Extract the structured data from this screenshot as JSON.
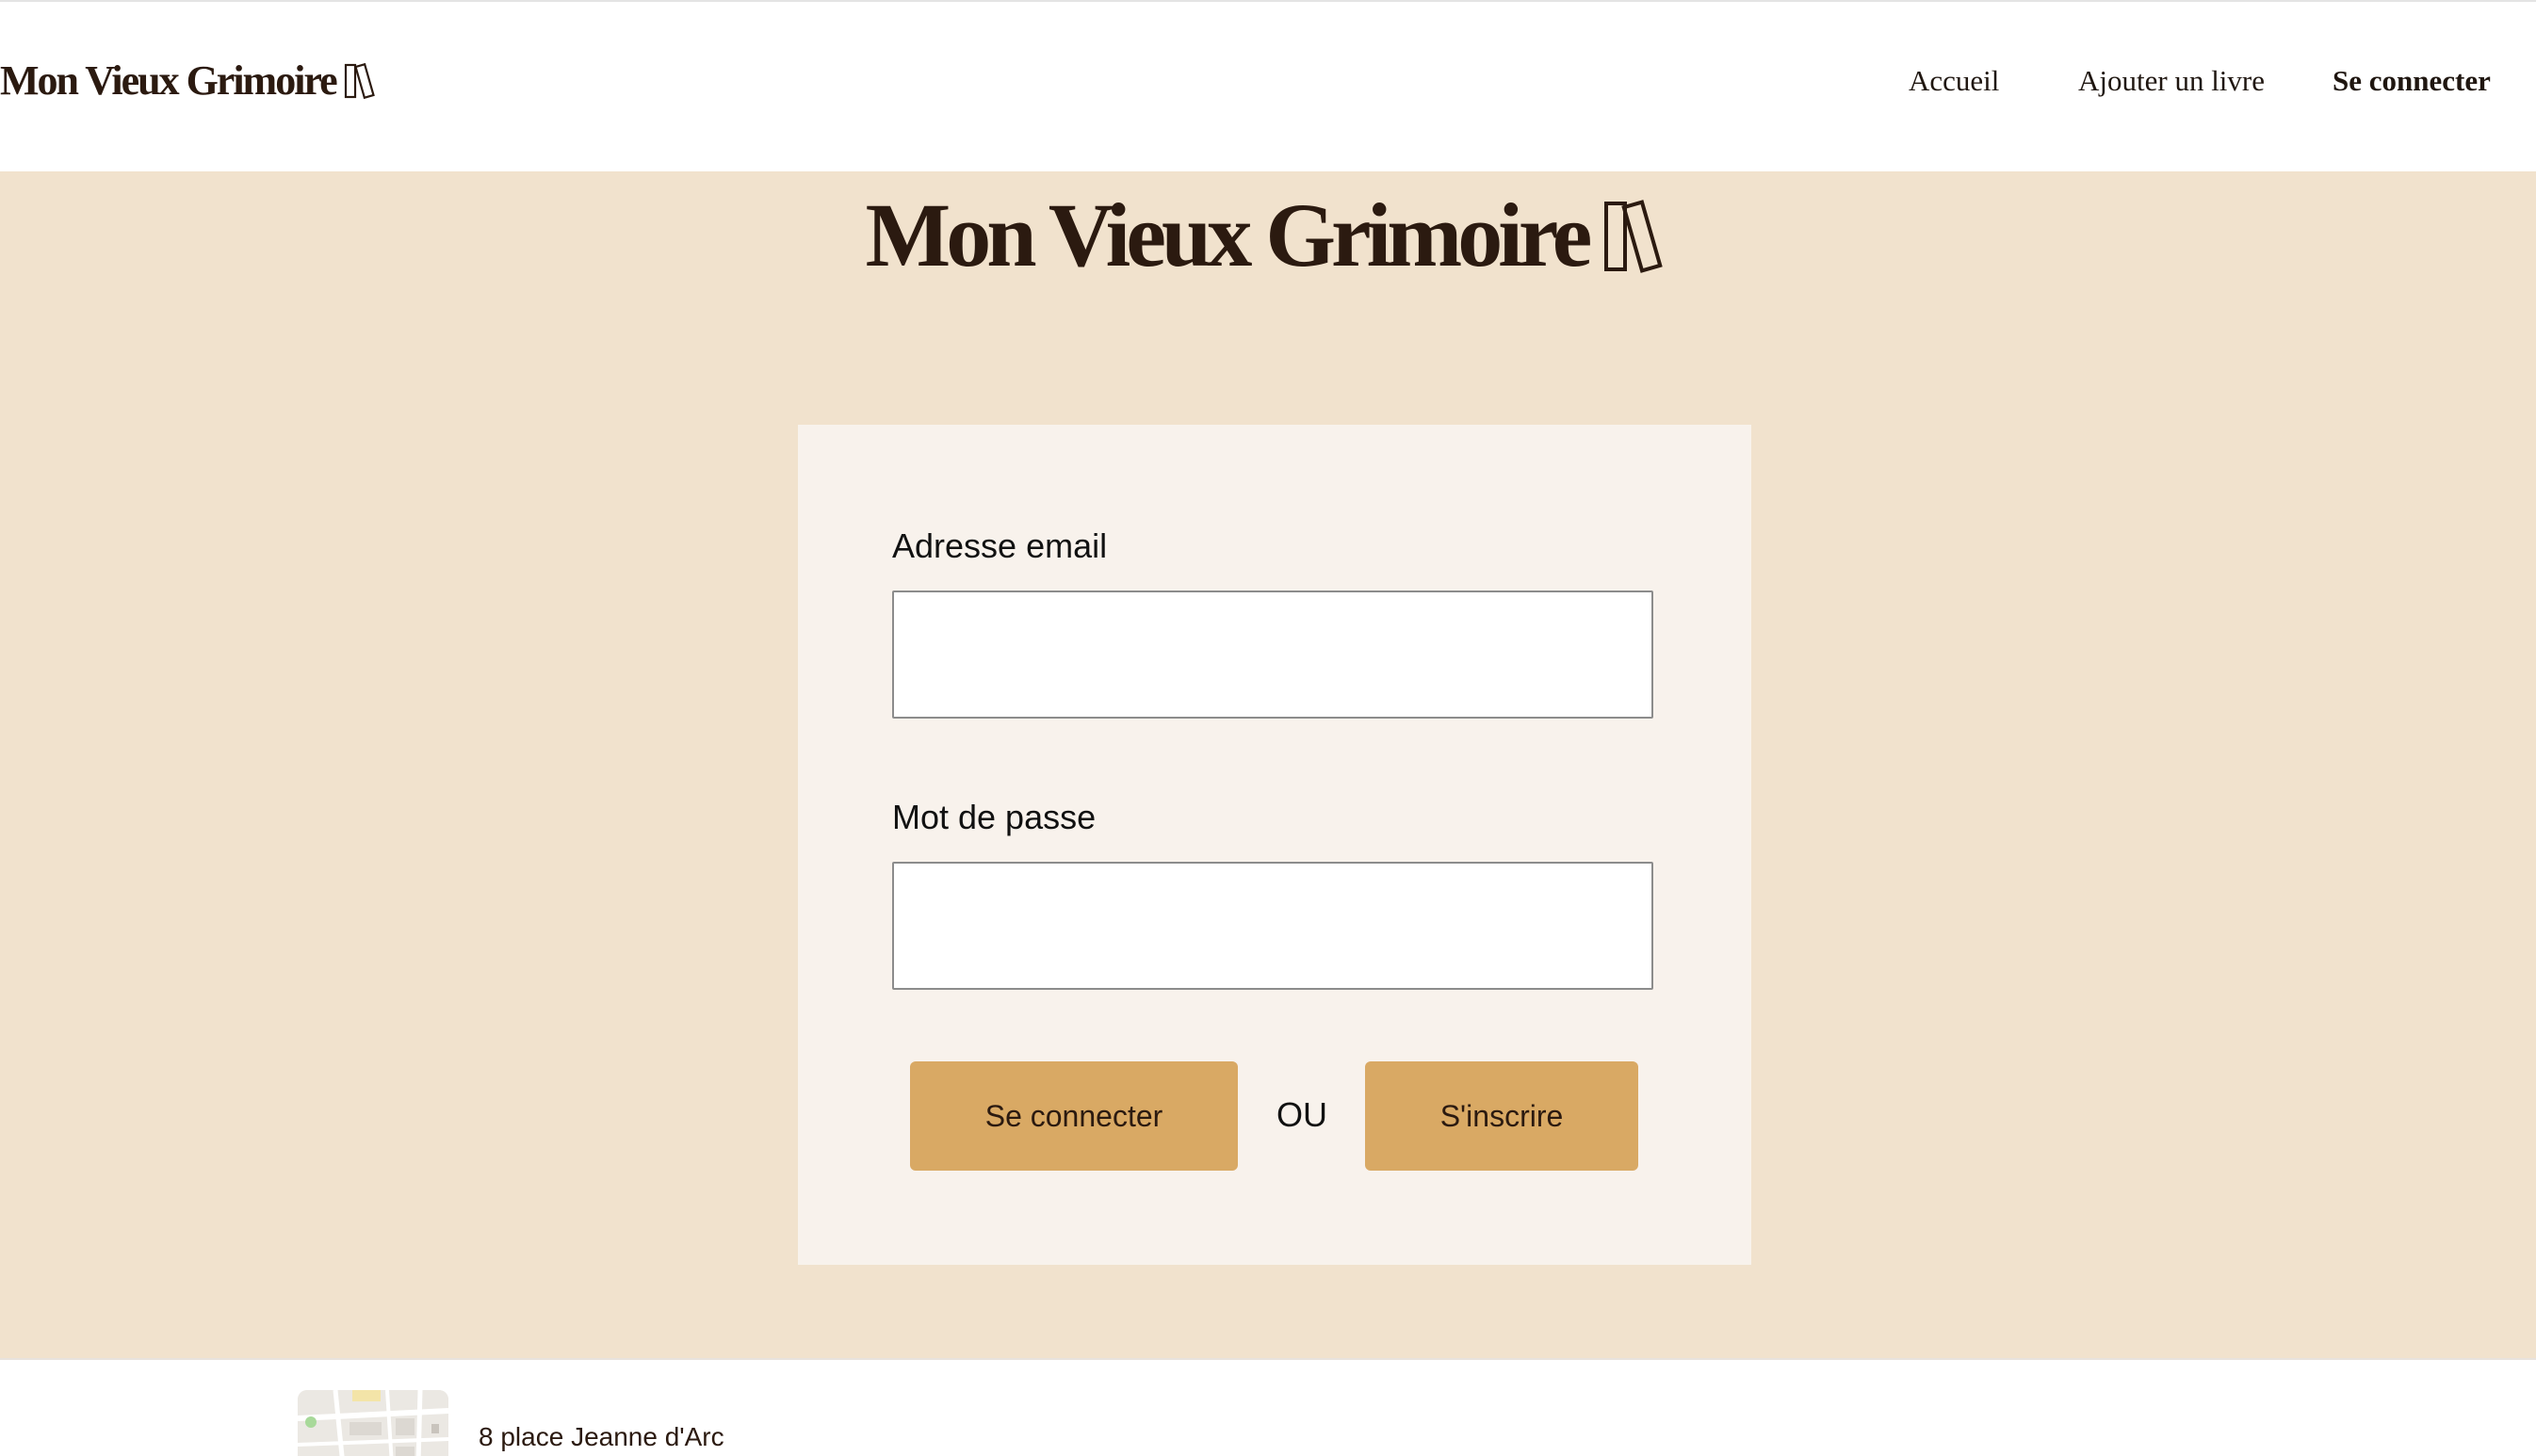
{
  "header": {
    "logo_text": "Mon Vieux Grimoire",
    "logo_icon": "books-icon",
    "nav": [
      {
        "label": "Accueil"
      },
      {
        "label": "Ajouter un livre"
      },
      {
        "label": "Se connecter",
        "active": true
      }
    ]
  },
  "hero": {
    "title": "Mon Vieux Grimoire",
    "icon": "books-icon"
  },
  "login_form": {
    "email_label": "Adresse email",
    "email_value": "",
    "password_label": "Mot de passe",
    "password_value": "",
    "login_button": "Se connecter",
    "or_label": "OU",
    "signup_button": "S'inscrire"
  },
  "footer": {
    "map_icon": "map-thumbnail",
    "address": "8 place Jeanne d'Arc"
  },
  "colors": {
    "main_background": "#f1e2cd",
    "card_background": "#f8f2ec",
    "button_background": "#d9a964",
    "text_dark": "#2b1a10"
  }
}
